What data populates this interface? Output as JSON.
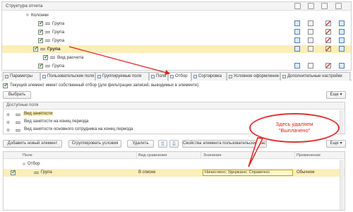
{
  "structure": {
    "title": "Структура отчета",
    "root_label": "Колонки",
    "rows": [
      {
        "label": "Група",
        "checked": true
      },
      {
        "label": "Група",
        "checked": true
      },
      {
        "label": "Група",
        "checked": true
      },
      {
        "label": "Група",
        "checked": true
      },
      {
        "label": "Вид расчета",
        "checked": true
      },
      {
        "label": "Група",
        "checked": true
      }
    ]
  },
  "tabs": [
    {
      "label": "Параметры"
    },
    {
      "label": "Пользовательские поля"
    },
    {
      "label": "Группируемые поля"
    },
    {
      "label": "Поля"
    },
    {
      "label": "Отбор"
    },
    {
      "label": "Сортировка"
    },
    {
      "label": "Условное оформление"
    },
    {
      "label": "Дополнительные настройки"
    }
  ],
  "filter_tab": {
    "own_filter_note": "Текущий элемент имеет собственный отбор (для фильтрации записей, выводимых в элементе)",
    "select_button": "Выбрать",
    "more_button": "Еще",
    "available_fields_header": "Доступные поля",
    "available_fields": [
      "Вид занятости",
      "Вид занятости на конец периода",
      "Вид занятости основного сотрудника на конец периода"
    ],
    "toolbar": {
      "add_new": "Добавить новый элемент",
      "group_conditions": "Сгруппировать условия",
      "delete": "Удалить",
      "element_properties": "Свойства элемента пользовательских настроек",
      "more": "Еще"
    },
    "columns": {
      "field": "Поле",
      "comparison": "Вид сравнения",
      "value": "Значение",
      "application": "Применение"
    },
    "rows": [
      {
        "field": "Отбор",
        "comparison": "",
        "value": "",
        "application": ""
      },
      {
        "field": "Група",
        "comparison": "В списке",
        "value": "Начислено; Удержано; Справочно",
        "application": "Обычное"
      }
    ]
  },
  "callout": {
    "line1": "Здесь удаляем",
    "line2": "\"Выплачено\""
  },
  "colors": {
    "selection": "#fbeeb8",
    "callout_red": "#dd2222",
    "check_green": "#1d8a1d"
  }
}
